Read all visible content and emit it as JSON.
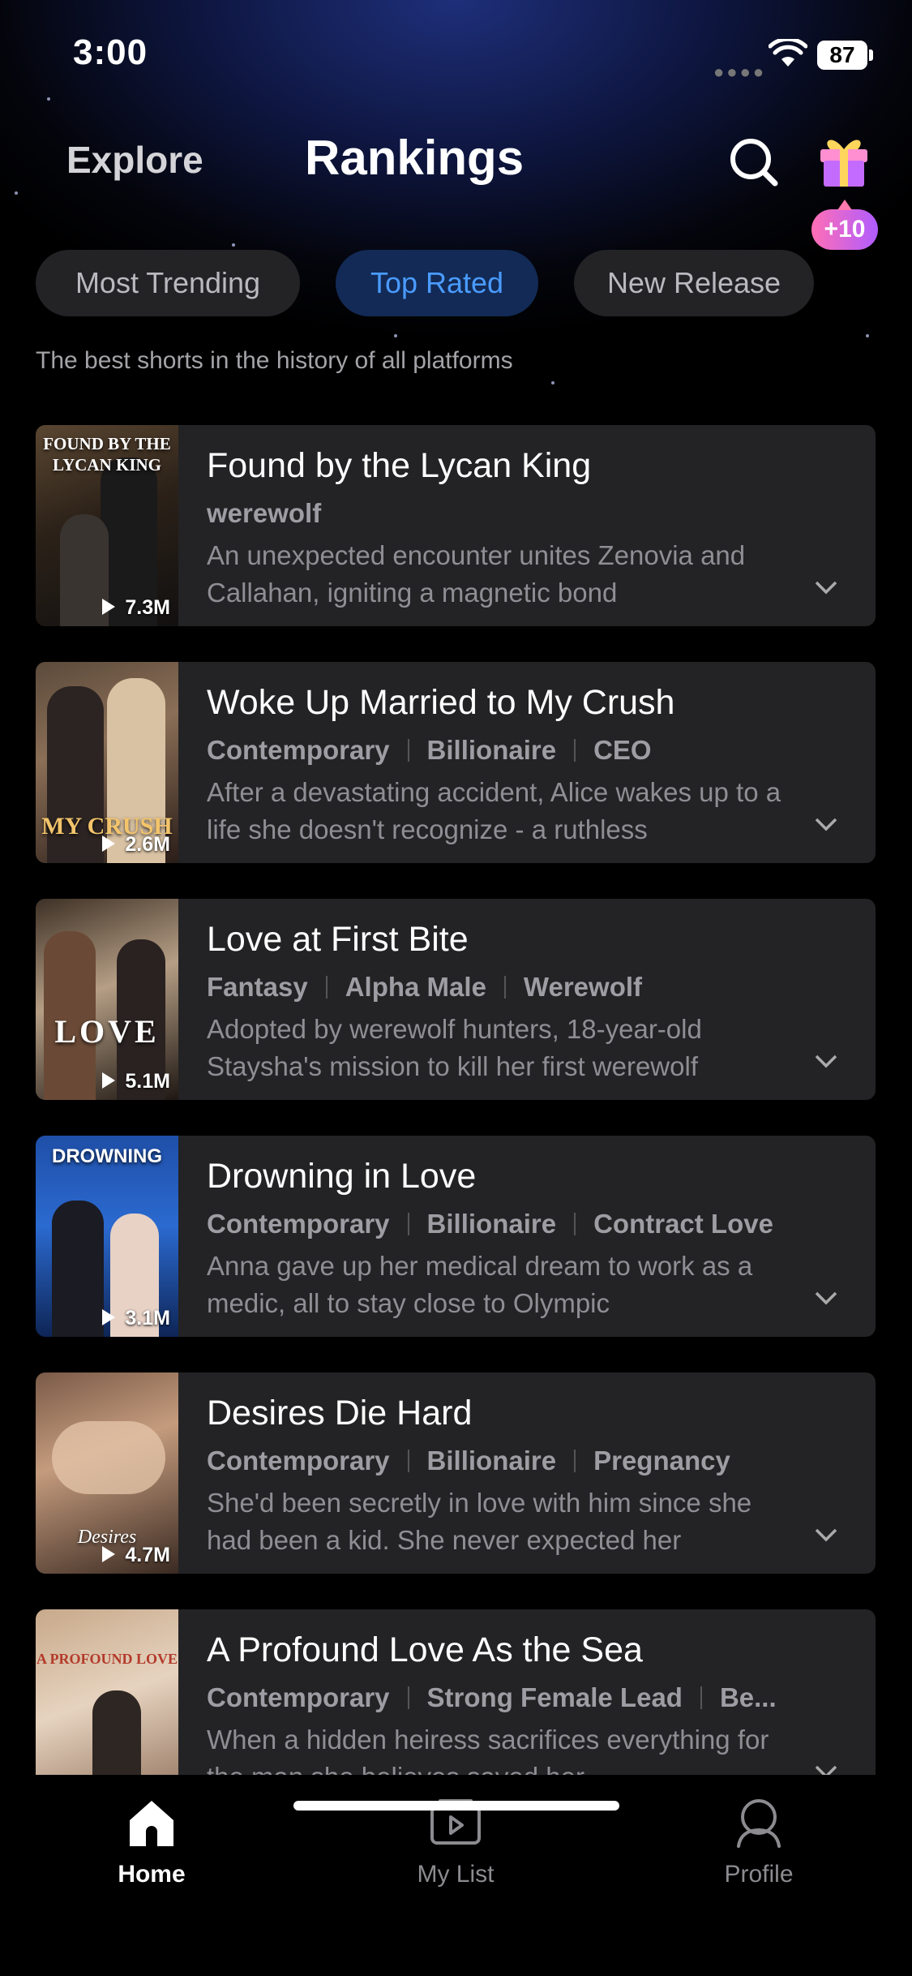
{
  "status_bar": {
    "time": "3:00",
    "battery": "87"
  },
  "header": {
    "explore": "Explore",
    "title": "Rankings",
    "gift_badge": "+10"
  },
  "tabs": [
    {
      "label": "Most Trending",
      "active": false
    },
    {
      "label": "Top Rated",
      "active": true
    },
    {
      "label": "New Release",
      "active": false
    }
  ],
  "subtitle": "The best shorts in the history of all platforms",
  "items": [
    {
      "title": "Found by the Lycan King",
      "tags": [
        "werewolf"
      ],
      "desc": "An unexpected encounter unites Zenovia and Callahan, igniting a magnetic bond",
      "views": "7.3M",
      "poster_text": "FOUND BY THE LYCAN KING"
    },
    {
      "title": "Woke Up Married to My Crush",
      "tags": [
        "Contemporary",
        "Billionaire",
        "CEO"
      ],
      "desc": "After a devastating accident, Alice wakes up to a life she doesn't recognize - a ruthless",
      "views": "2.6M",
      "poster_text": "MY CRUSH"
    },
    {
      "title": "Love at First Bite",
      "tags": [
        "Fantasy",
        "Alpha Male",
        "Werewolf"
      ],
      "desc": "Adopted by werewolf hunters, 18-year-old Staysha's mission to kill her first werewolf",
      "views": "5.1M",
      "poster_text": "LOVE"
    },
    {
      "title": "Drowning in Love",
      "tags": [
        "Contemporary",
        "Billionaire",
        "Contract Love"
      ],
      "desc": "Anna gave up her medical dream to work as a medic, all to stay close to Olympic",
      "views": "3.1M",
      "poster_text": "DROWNING"
    },
    {
      "title": "Desires Die Hard",
      "tags": [
        "Contemporary",
        "Billionaire",
        "Pregnancy"
      ],
      "desc": "She'd been secretly in love with him since she had been a kid. She never expected her",
      "views": "4.7M",
      "poster_text": "Desires"
    },
    {
      "title": "A Profound Love As the Sea",
      "tags": [
        "Contemporary",
        "Strong Female Lead",
        "Be..."
      ],
      "desc": "When a hidden heiress sacrifices everything for the man she believes saved her",
      "views": "",
      "poster_text": "A PROFOUND LOVE"
    }
  ],
  "nav": {
    "home": "Home",
    "my_list": "My List",
    "profile": "Profile"
  },
  "colors": {
    "accent": "#4a9bff",
    "card_bg": "#232325",
    "badge_gradient_start": "#ff6fb5",
    "badge_gradient_end": "#b05cff"
  }
}
